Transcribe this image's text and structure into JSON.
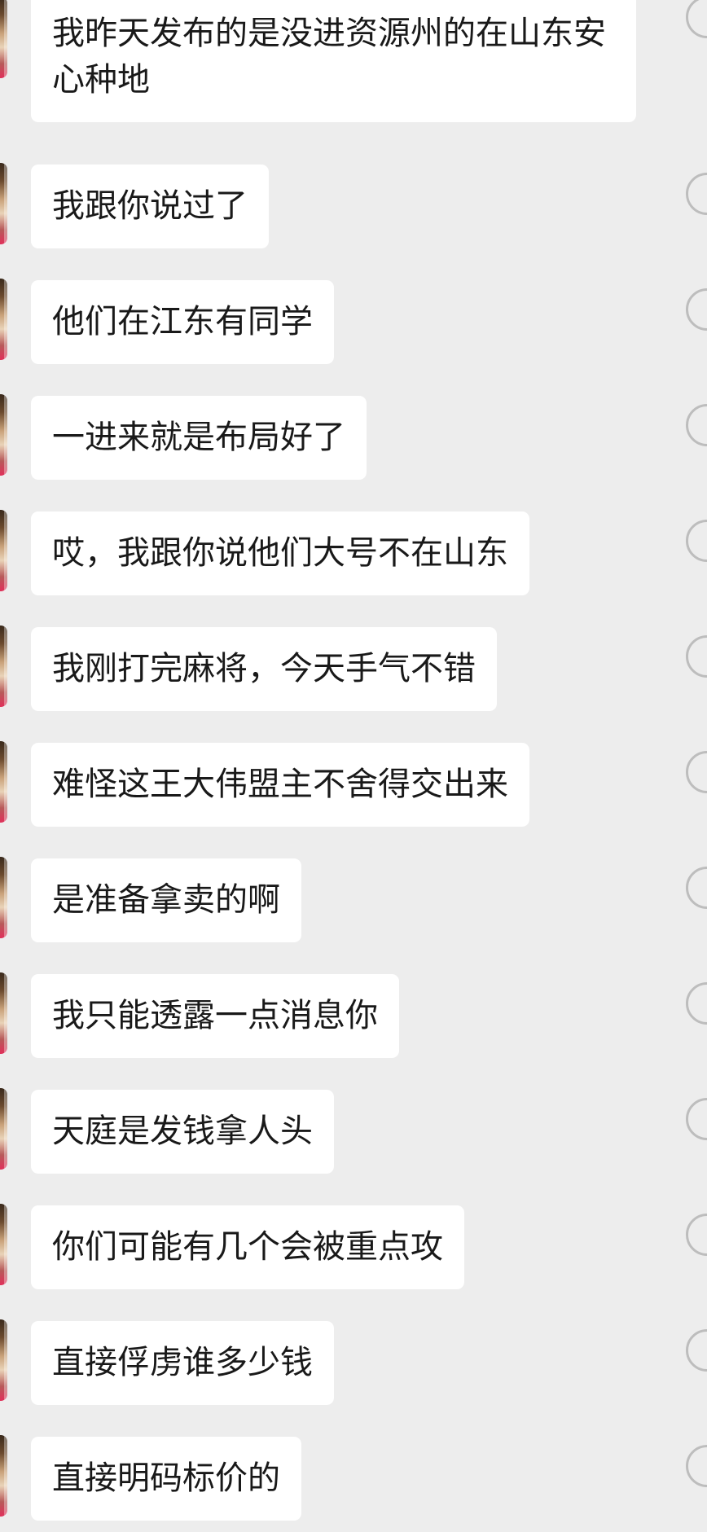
{
  "messages": [
    {
      "text": "我昨天发布的是没进资源州的在山东安心种地",
      "multiline": true
    },
    {
      "text": "我跟你说过了"
    },
    {
      "text": "他们在江东有同学"
    },
    {
      "text": "一进来就是布局好了"
    },
    {
      "text": "哎，我跟你说他们大号不在山东"
    },
    {
      "text": "我刚打完麻将，今天手气不错"
    },
    {
      "text": "难怪这王大伟盟主不舍得交出来"
    },
    {
      "text": "是准备拿卖的啊"
    },
    {
      "text": "我只能透露一点消息你"
    },
    {
      "text": "天庭是发钱拿人头"
    },
    {
      "text": "你们可能有几个会被重点攻"
    },
    {
      "text": "直接俘虏谁多少钱"
    },
    {
      "text": "直接明码标价的"
    }
  ]
}
